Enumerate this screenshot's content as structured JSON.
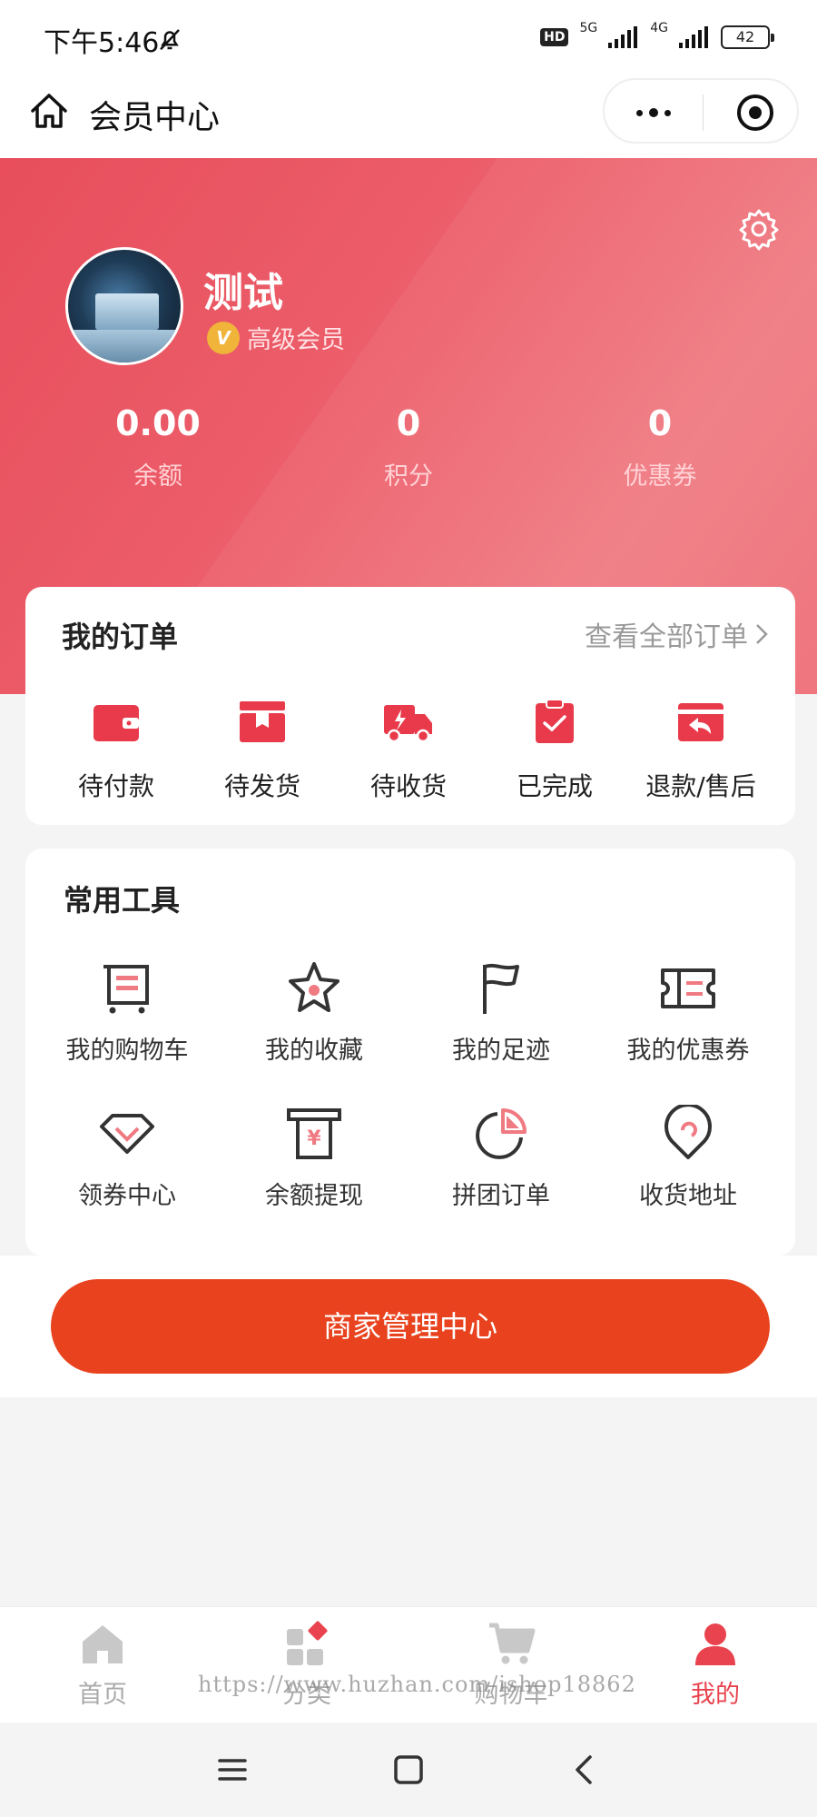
{
  "status_bar": {
    "time": "下午5:46",
    "hd": "HD",
    "net1": "5G",
    "net2": "4G",
    "battery": "42"
  },
  "nav": {
    "title": "会员中心"
  },
  "profile": {
    "name": "测试",
    "member_level": "高级会员",
    "stats": [
      {
        "value": "0.00",
        "label": "余额"
      },
      {
        "value": "0",
        "label": "积分"
      },
      {
        "value": "0",
        "label": "优惠券"
      }
    ]
  },
  "orders": {
    "title": "我的订单",
    "view_all": "查看全部订单",
    "items": [
      {
        "label": "待付款",
        "icon": "wallet-icon"
      },
      {
        "label": "待发货",
        "icon": "box-icon"
      },
      {
        "label": "待收货",
        "icon": "truck-icon"
      },
      {
        "label": "已完成",
        "icon": "clipboard-check-icon"
      },
      {
        "label": "退款/售后",
        "icon": "refund-icon"
      }
    ]
  },
  "tools": {
    "title": "常用工具",
    "items": [
      {
        "label": "我的购物车",
        "icon": "cart-icon"
      },
      {
        "label": "我的收藏",
        "icon": "star-icon"
      },
      {
        "label": "我的足迹",
        "icon": "flag-icon"
      },
      {
        "label": "我的优惠券",
        "icon": "ticket-icon"
      },
      {
        "label": "领券中心",
        "icon": "diamond-icon"
      },
      {
        "label": "余额提现",
        "icon": "withdraw-icon"
      },
      {
        "label": "拼团订单",
        "icon": "pie-icon"
      },
      {
        "label": "收货地址",
        "icon": "location-icon"
      }
    ]
  },
  "merchant_button": "商家管理中心",
  "tabbar": [
    {
      "label": "首页",
      "icon": "home-icon"
    },
    {
      "label": "分类",
      "icon": "category-icon"
    },
    {
      "label": "购物车",
      "icon": "cart-icon"
    },
    {
      "label": "我的",
      "icon": "user-icon"
    }
  ],
  "watermark": "https://www.huzhan.com/ishop18862",
  "colors": {
    "accent": "#e8434e",
    "merchant_button": "#e8431e",
    "hero_start": "#e84e5c",
    "hero_end": "#f07a82"
  }
}
